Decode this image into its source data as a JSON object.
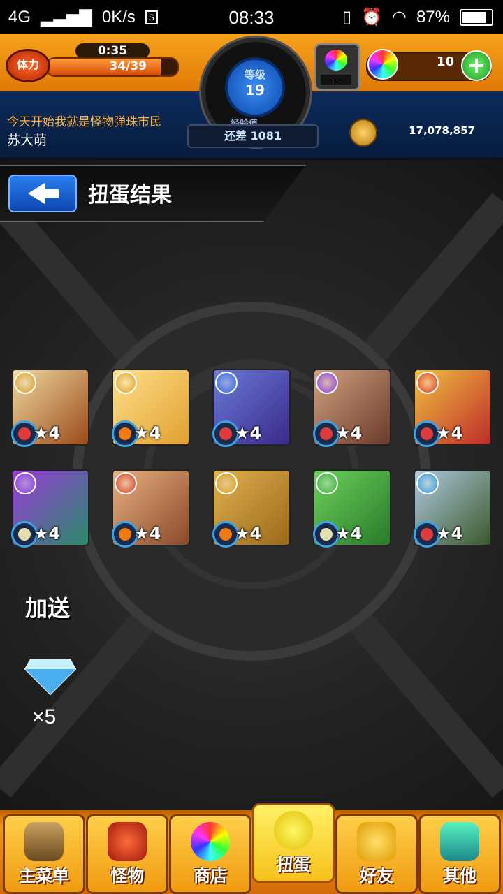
{
  "status_bar": {
    "network": "4G",
    "speed": "0K/s",
    "s_icon": "S",
    "time": "08:33",
    "battery": "87%",
    "battery_level": 0.87
  },
  "hud": {
    "stamina_label": "体力",
    "stamina_timer": "0:35",
    "stamina_value": "34/39",
    "stamina_fraction": 0.87,
    "level_label": "等级",
    "level_value": "19",
    "exp_label": "经验值",
    "exp_remaining": "还差 1081",
    "egg_count": "---",
    "gem_count": "10",
    "player_title": "今天开始我就是怪物弹珠市民",
    "player_name": "苏大萌",
    "coins": "17,078,857"
  },
  "page": {
    "title": "扭蛋结果"
  },
  "results": [
    {
      "star": "★4",
      "attr_color": "#d9a21a",
      "fruit_color": "#e03a3a",
      "art": [
        "#f0d9a0",
        "#9a4a1a"
      ]
    },
    {
      "star": "★4",
      "attr_color": "#d9a21a",
      "fruit_color": "#f07a10",
      "art": [
        "#ffe08a",
        "#e0a030"
      ]
    },
    {
      "star": "★4",
      "attr_color": "#2a6ae0",
      "fruit_color": "#e03a3a",
      "art": [
        "#6a7ad8",
        "#3a2a8a"
      ]
    },
    {
      "star": "★4",
      "attr_color": "#8a3ae0",
      "fruit_color": "#e03a3a",
      "art": [
        "#d0a080",
        "#6a3a2a"
      ]
    },
    {
      "star": "★4",
      "attr_color": "#e03a1a",
      "fruit_color": "#e03a3a",
      "art": [
        "#f0c040",
        "#c02a2a"
      ]
    },
    {
      "star": "★4",
      "attr_color": "#8a3ae0",
      "fruit_color": "#e0e0b0",
      "art": [
        "#9a3ad8",
        "#2a8a6a"
      ]
    },
    {
      "star": "★4",
      "attr_color": "#e03a1a",
      "fruit_color": "#f07a10",
      "art": [
        "#e8b080",
        "#8a4a2a"
      ]
    },
    {
      "star": "★4",
      "attr_color": "#d9a21a",
      "fruit_color": "#f07a10",
      "art": [
        "#e0b050",
        "#9a6a1a"
      ]
    },
    {
      "star": "★4",
      "attr_color": "#3ab03a",
      "fruit_color": "#e0e0b0",
      "art": [
        "#6ad05a",
        "#2a7a2a"
      ]
    },
    {
      "star": "★4",
      "attr_color": "#2a9ae0",
      "fruit_color": "#e03a3a",
      "art": [
        "#b0c8e0",
        "#3a5a2a"
      ]
    }
  ],
  "bonus": {
    "label": "加送",
    "count": "×5"
  },
  "nav": [
    {
      "label": "主菜单",
      "icon": "gate-icon"
    },
    {
      "label": "怪物",
      "icon": "monster-icon"
    },
    {
      "label": "商店",
      "icon": "orb-icon"
    },
    {
      "label": "扭蛋",
      "icon": "egg-icon"
    },
    {
      "label": "好友",
      "icon": "friends-icon"
    },
    {
      "label": "其他",
      "icon": "other-icon"
    }
  ],
  "colors": {
    "accent_orange": "#f49a1a",
    "hud_blue": "#0c2c5c",
    "back_button_blue": "#2a7ef0"
  }
}
